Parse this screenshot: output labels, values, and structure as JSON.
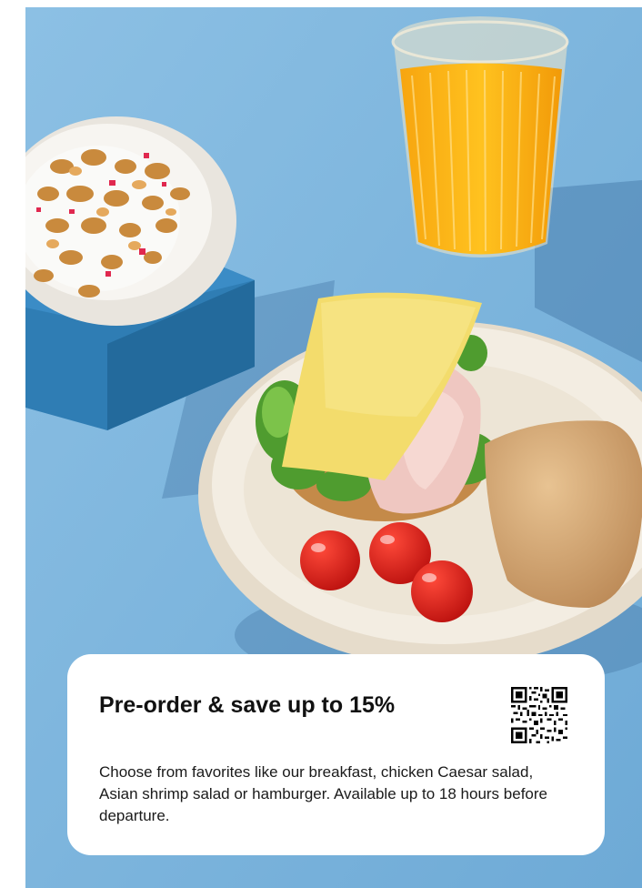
{
  "promo": {
    "headline": "Pre-order & save up to 15%",
    "description": "Choose from favorites like our breakfast, chicken Caesar salad, Asian shrimp salad or hamburger. Available up to 18 hours before departure.",
    "qr_icon": "qr-code-icon"
  },
  "colors": {
    "background": "#7fb6dc",
    "card": "#ffffff",
    "text": "#111111"
  }
}
